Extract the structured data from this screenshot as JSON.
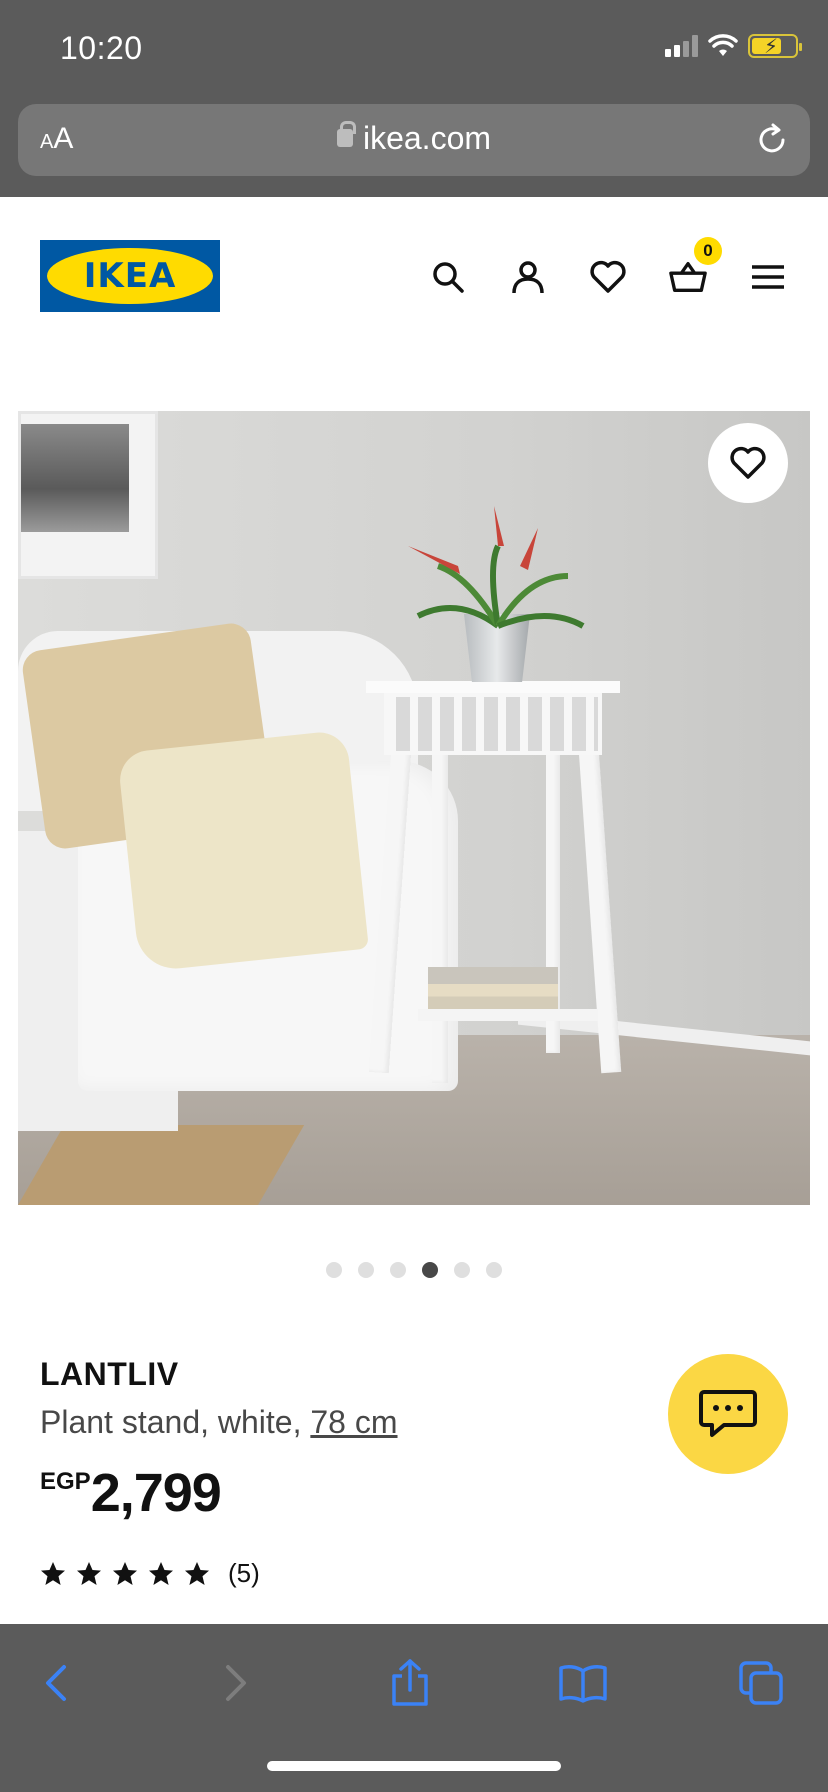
{
  "status_bar": {
    "time": "10:20"
  },
  "browser": {
    "text_size_label_small": "A",
    "text_size_label_large": "A",
    "url": "ikea.com"
  },
  "header": {
    "logo_text": "IKEA",
    "cart_count": "0"
  },
  "carousel": {
    "total": 6,
    "active_index": 3
  },
  "product": {
    "name": "LANTLIV",
    "description": "Plant stand, white, ",
    "size_link": "78 cm",
    "currency": "EGP",
    "price": "2,799",
    "rating_stars": 5,
    "rating_count": "(5)"
  },
  "colors": {
    "ikea_blue": "#0058a3",
    "ikea_yellow": "#ffdb00",
    "safari_chrome": "#5b5b5b",
    "toolbar_icon_blue": "#3b82f6",
    "chat_button": "#fbd744"
  }
}
